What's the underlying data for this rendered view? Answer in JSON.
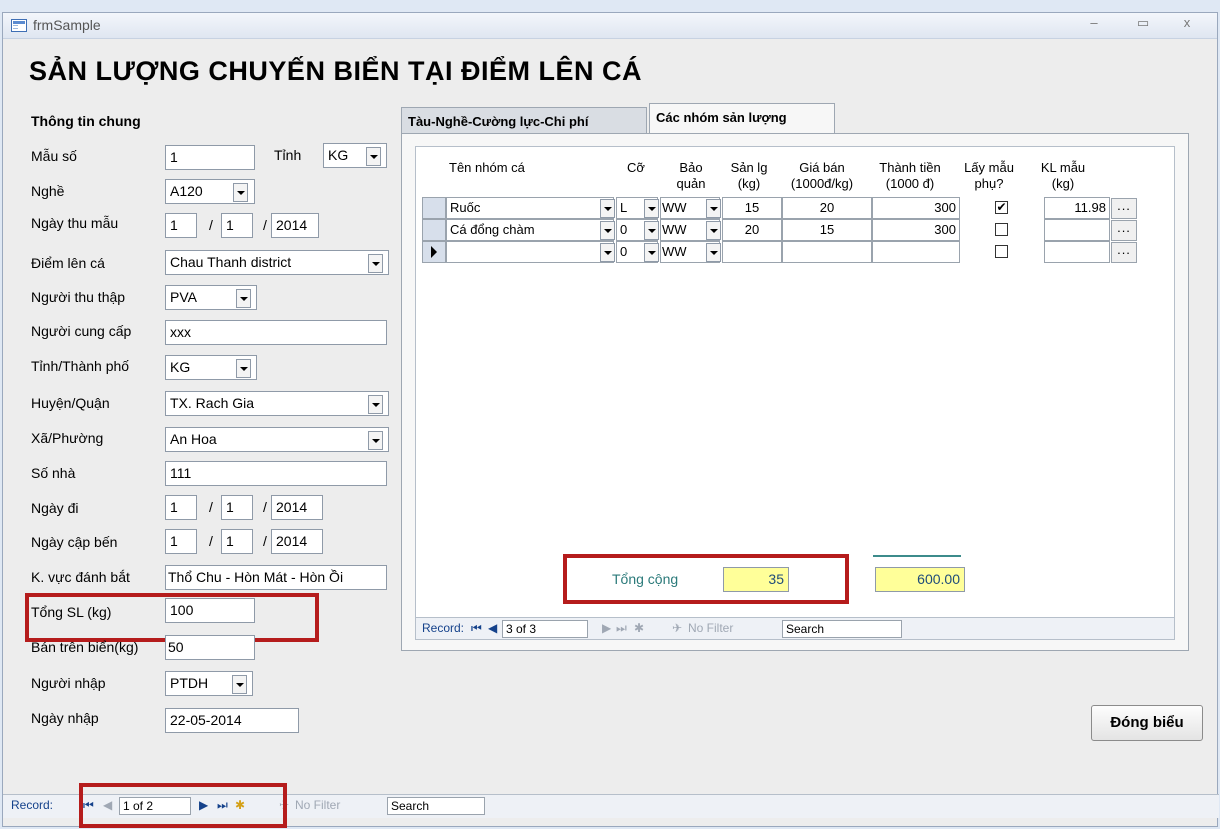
{
  "window": {
    "title": "frmSample",
    "minimize": "–",
    "maximize": "▭",
    "close": "x"
  },
  "form_title": "SẢN LƯỢNG CHUYẾN BIỂN TẠI ĐIỂM LÊN CÁ",
  "general": {
    "heading": "Thông tin chung",
    "mau_so_label": "Mẫu số",
    "mau_so": "1",
    "tinh_label": "Tỉnh",
    "tinh": "KG",
    "nghe_label": "Nghề",
    "nghe": "A120",
    "ngay_thu_mau_label": "Ngày thu mẫu",
    "ngay_thu_mau": {
      "d": "1",
      "m": "1",
      "y": "2014"
    },
    "diem_len_ca_label": "Điểm lên cá",
    "diem_len_ca": "Chau Thanh district",
    "nguoi_thu_thap_label": "Người thu thập",
    "nguoi_thu_thap": "PVA",
    "nguoi_cung_cap_label": "Người cung cấp",
    "nguoi_cung_cap": "xxx",
    "tinh_tp_label": "Tỉnh/Thành phố",
    "tinh_tp": "KG",
    "huyen_label": "Huyện/Quận",
    "huyen": "TX. Rach Gia",
    "xa_label": "Xã/Phường",
    "xa": "An Hoa",
    "so_nha_label": "Số nhà",
    "so_nha": "111",
    "ngay_di_label": "Ngày đi",
    "ngay_di": {
      "d": "1",
      "m": "1",
      "y": "2014"
    },
    "ngay_cap_ben_label": "Ngày cập bến",
    "ngay_cap_ben": {
      "d": "1",
      "m": "1",
      "y": "2014"
    },
    "khu_vuc_label": "K. vực đánh bắt",
    "khu_vuc": "Thổ Chu - Hòn Mát - Hòn Ồi",
    "tong_sl_label": "Tổng SL (kg)",
    "tong_sl": "100",
    "ban_tren_bien_label": "Bán trên biển(kg)",
    "ban_tren_bien": "50",
    "nguoi_nhap_label": "Người nhập",
    "nguoi_nhap": "PTDH",
    "ngay_nhap_label": "Ngày nhập",
    "ngay_nhap": "22-05-2014",
    "date_sep": "/"
  },
  "tabs": [
    {
      "label": "Tàu-Nghề-Cường lực-Chi phí"
    },
    {
      "label": "Các nhóm sản lượng"
    }
  ],
  "grid": {
    "headers": {
      "ten": "Tên nhóm cá",
      "co": "Cỡ",
      "bao_quan": "Bảo\nquản",
      "san_lg": "Sản lg\n(kg)",
      "gia_ban": "Giá bán\n(1000đ/kg)",
      "thanh_tien": "Thành tiền\n(1000 đ)",
      "lay_mau": "Lấy mẫu\nphụ?",
      "kl_mau": "KL mẫu\n(kg)"
    },
    "rows": [
      {
        "ten": "Ruốc",
        "co": "L",
        "bq": "WW",
        "sl": "15",
        "gia": "20",
        "tt": "300",
        "lay": "✔",
        "kl": "11.98"
      },
      {
        "ten": "Cá đổng chàm",
        "co": "0",
        "bq": "WW",
        "sl": "20",
        "gia": "15",
        "tt": "300",
        "lay": "",
        "kl": ""
      },
      {
        "ten": "",
        "co": "0",
        "bq": "WW",
        "sl": "",
        "gia": "",
        "tt": "",
        "lay": "",
        "kl": ""
      }
    ],
    "ellipsis": "...",
    "total_label": "Tổng cộng",
    "total_sl": "35",
    "total_tt": "600.00",
    "nav": {
      "record_label": "Record:",
      "position": "3 of 3",
      "filter": "No Filter",
      "search": "Search"
    }
  },
  "close_button": "Đóng biểu",
  "main_nav": {
    "record_label": "Record:",
    "position": "1 of 2",
    "filter": "No Filter",
    "search": "Search"
  },
  "colors": {
    "highlight": "#b51c1c",
    "total_fill": "#ffff99"
  }
}
